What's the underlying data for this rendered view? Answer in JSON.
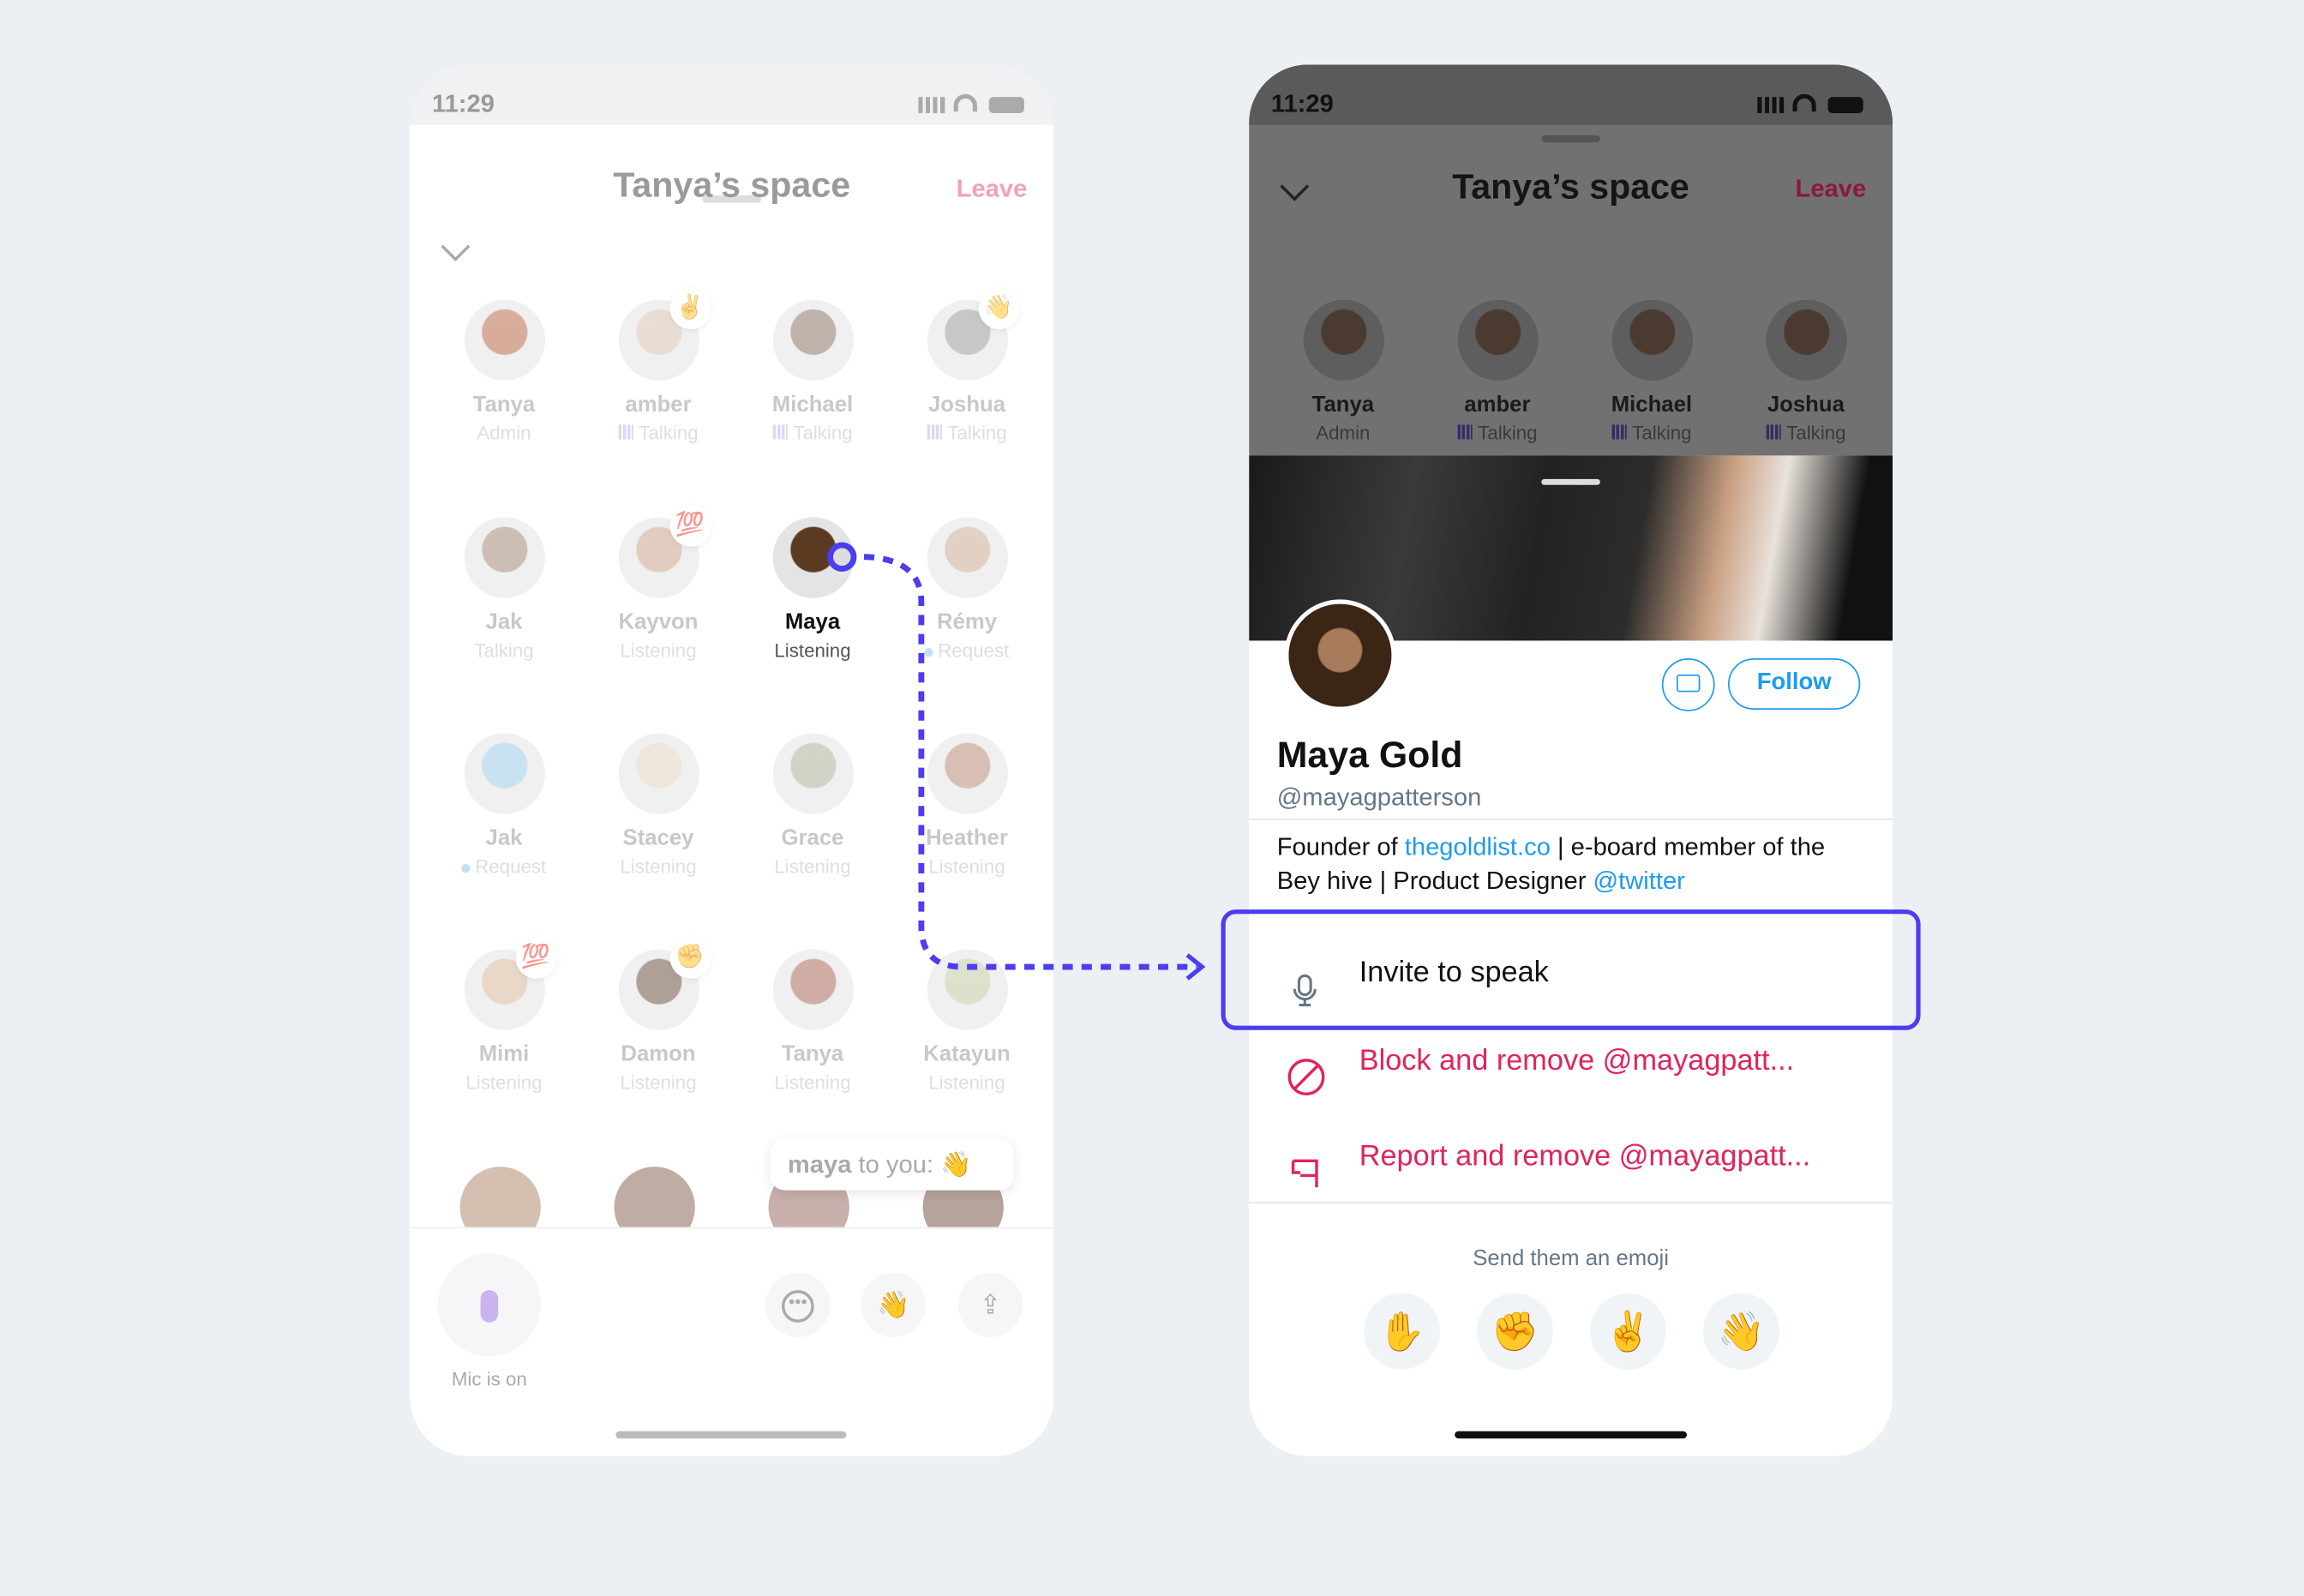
{
  "left_phone": {
    "time": "11:29",
    "title": "Tanya’s space",
    "leave_label": "Leave",
    "participants": [
      {
        "name": "Tanya",
        "status": "Admin",
        "color": "#b86a4a"
      },
      {
        "name": "amber",
        "status": "Talking",
        "talking": true,
        "reaction": "✌",
        "color": "#d8c2b0"
      },
      {
        "name": "Michael",
        "status": "Talking",
        "talking": true,
        "color": "#8a7566"
      },
      {
        "name": "Joshua",
        "status": "Talking",
        "talking": true,
        "reaction": "👋",
        "color": "#9a9a9a"
      },
      {
        "name": "Jak",
        "status": "Talking",
        "color": "#a38a78"
      },
      {
        "name": "Kayvon",
        "status": "Listening",
        "reaction": "💯",
        "color": "#c9a58c"
      },
      {
        "name": "Maya",
        "status": "Listening",
        "selected": true,
        "color": "#5b3a22"
      },
      {
        "name": "Rémy",
        "status": "Request",
        "request": true,
        "color": "#c9ab93"
      },
      {
        "name": "Jak",
        "status": "Request",
        "request": true,
        "color": "#9ccbe8"
      },
      {
        "name": "Stacey",
        "status": "Listening",
        "color": "#e2d2bf"
      },
      {
        "name": "Grace",
        "status": "Listening",
        "color": "#a9b29a"
      },
      {
        "name": "Heather",
        "status": "Listening",
        "color": "#b98b76"
      },
      {
        "name": "Mimi",
        "status": "Listening",
        "reaction": "💯",
        "color": "#d8b89a"
      },
      {
        "name": "Damon",
        "status": "Listening",
        "reaction": "✊",
        "color": "#6c5243"
      },
      {
        "name": "Tanya",
        "status": "Listening",
        "color": "#a86a5a"
      },
      {
        "name": "Katayun",
        "status": "Listening",
        "color": "#c2c8a2"
      }
    ],
    "toast": {
      "sender": "maya",
      "text": " to you:",
      "emoji": "👋"
    },
    "mic_label": "Mic is on",
    "icons": [
      "microphone-icon",
      "more-icon",
      "wave-icon",
      "share-icon"
    ]
  },
  "right_phone": {
    "time": "11:29",
    "title": "Tanya’s space",
    "leave_label": "Leave",
    "speakers": [
      {
        "name": "Tanya",
        "status": "Admin"
      },
      {
        "name": "amber",
        "status": "Talking"
      },
      {
        "name": "Michael",
        "status": "Talking"
      },
      {
        "name": "Joshua",
        "status": "Talking"
      }
    ],
    "profile": {
      "name": "Maya Gold",
      "handle": "@mayagpatterson",
      "follow_label": "Follow",
      "bio_1": "Founder of ",
      "bio_link_1": "thegoldlist.co",
      "bio_2": " | e-board member of the Bey hive | Product Designer ",
      "bio_link_2": "@twitter"
    },
    "menu": {
      "invite": "Invite to speak",
      "block": "Block and remove @mayagpatt...",
      "report": "Report and remove @mayagpatt..."
    },
    "emoji_prompt": "Send them an emoji",
    "emojis": [
      "✋",
      "✊",
      "✌",
      "👋"
    ]
  },
  "colors": {
    "accent": "#4b3df0",
    "twitter_blue": "#1d9bf0",
    "danger": "#e0245e",
    "background": "#eceff3"
  }
}
